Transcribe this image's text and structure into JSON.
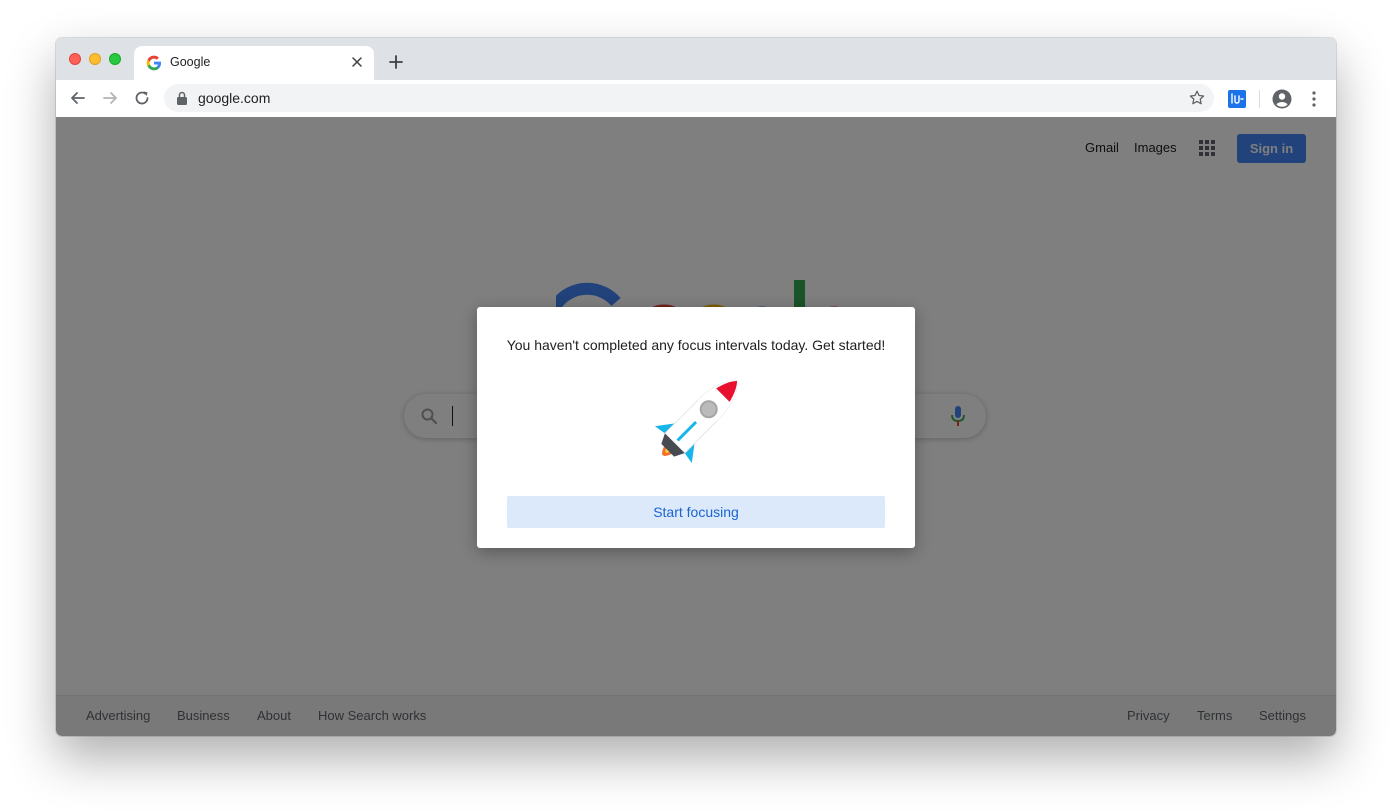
{
  "browser": {
    "tab": {
      "title": "Google",
      "favicon": "google-g-icon",
      "close_icon": "close-icon"
    },
    "new_tab_icon": "plus-icon",
    "toolbar": {
      "back_icon": "arrow-left-icon",
      "forward_icon": "arrow-right-icon",
      "reload_icon": "reload-icon",
      "lock_icon": "lock-icon",
      "url": "google.com",
      "bookmark_icon": "star-icon",
      "extension_icon": "extension-icon",
      "profile_icon": "account-circle-icon",
      "menu_icon": "more-vert-icon"
    }
  },
  "page": {
    "header": {
      "links": [
        "Gmail",
        "Images"
      ],
      "apps_icon": "apps-grid-icon",
      "sign_in_label": "Sign in"
    },
    "search": {
      "search_icon": "search-icon",
      "mic_icon": "microphone-icon"
    },
    "footer": {
      "left_links": [
        "Advertising",
        "Business",
        "About",
        "How Search works"
      ],
      "right_links": [
        "Privacy",
        "Terms",
        "Settings"
      ]
    }
  },
  "dialog": {
    "message": "You haven't completed any focus intervals today. Get started!",
    "image": "rocket-icon",
    "button_label": "Start focusing"
  },
  "colors": {
    "sign_in": "#4285f4",
    "overlay": "rgba(0,0,0,0.5)",
    "start_button_bg": "#dbe9fb",
    "start_button_text": "#1a64d0"
  }
}
